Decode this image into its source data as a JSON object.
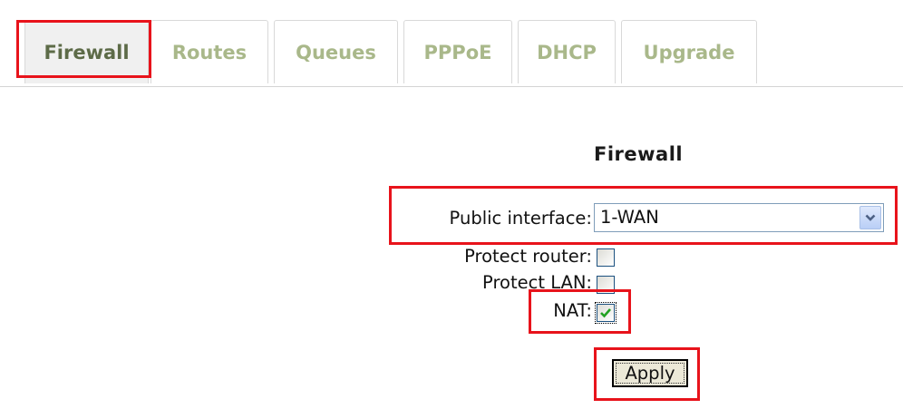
{
  "tabs": [
    {
      "label": "Firewall",
      "active": true
    },
    {
      "label": "Routes",
      "active": false
    },
    {
      "label": "Queues",
      "active": false
    },
    {
      "label": "PPPoE",
      "active": false
    },
    {
      "label": "DHCP",
      "active": false
    },
    {
      "label": "Upgrade",
      "active": false
    }
  ],
  "panel": {
    "heading": "Firewall",
    "public_interface": {
      "label": "Public interface:",
      "value": "1-WAN",
      "icon": "chevron-down-icon"
    },
    "protect_router": {
      "label": "Protect router:",
      "checked": false
    },
    "protect_lan": {
      "label": "Protect LAN:",
      "checked": false
    },
    "nat": {
      "label": "NAT:",
      "checked": true,
      "icon": "checkmark-icon"
    },
    "apply_label": "Apply"
  },
  "colors": {
    "annotation": "#e8131b",
    "tab_active_text": "#5d6b48",
    "tab_inactive_text": "#a9b88a",
    "checkmark": "#21a121"
  }
}
